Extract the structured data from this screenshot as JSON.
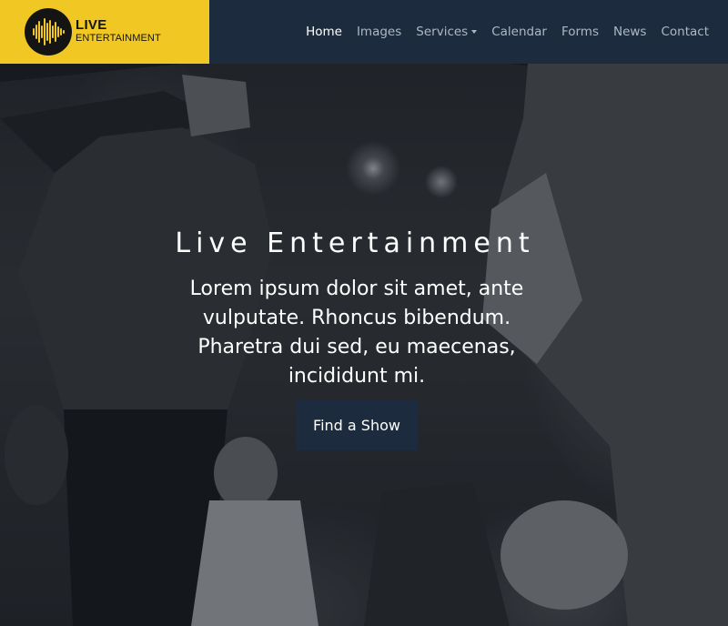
{
  "brand": {
    "line1": "LIVE",
    "line2": "ENTERTAINMENT",
    "logo_icon": "soundwave-icon",
    "bg_color": "#f1c823"
  },
  "nav": {
    "items": [
      {
        "label": "Home",
        "active": true
      },
      {
        "label": "Images"
      },
      {
        "label": "Services",
        "dropdown": true
      },
      {
        "label": "Calendar"
      },
      {
        "label": "Forms"
      },
      {
        "label": "News"
      },
      {
        "label": "Contact"
      }
    ],
    "bg_color": "#1c2b3d"
  },
  "hero": {
    "title": "Live Entertainment",
    "lead": "Lorem ipsum dolor sit amet, ante vulputate. Rhoncus bibendum. Pharetra dui sed, eu maecenas, incididunt mi.",
    "cta_label": "Find a Show",
    "background_icon": "concert-crowd-photo"
  }
}
